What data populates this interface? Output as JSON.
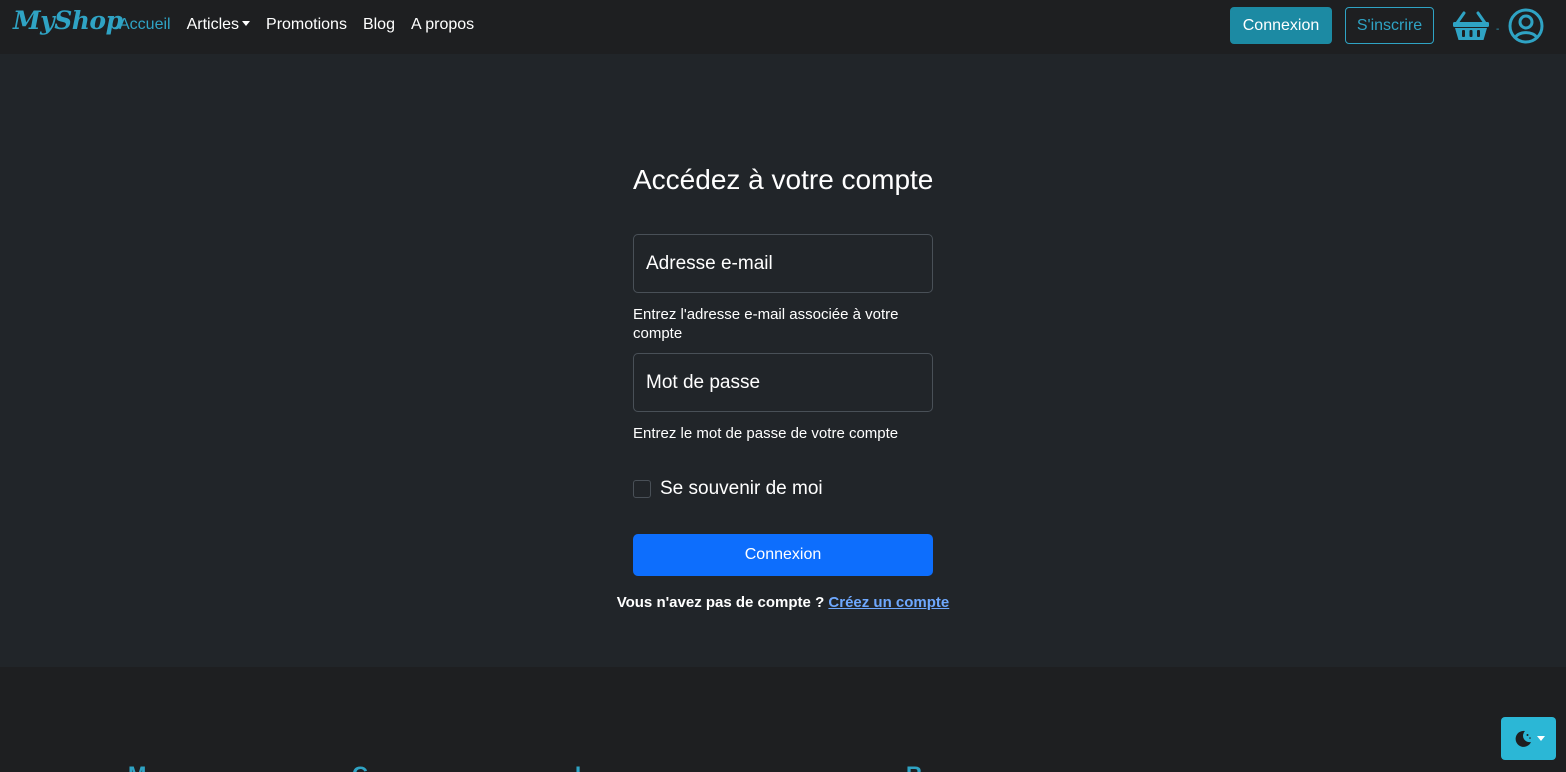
{
  "navbar": {
    "brand": "MyShop",
    "links": [
      {
        "label": "Accueil",
        "active": true
      },
      {
        "label": "Articles",
        "dropdown": true
      },
      {
        "label": "Promotions"
      },
      {
        "label": "Blog"
      },
      {
        "label": "A propos"
      }
    ],
    "login_label": "Connexion",
    "register_label": "S'inscrire",
    "cart_count": "-",
    "accent_color": "#2fa3c4"
  },
  "login_form": {
    "title": "Accédez à votre compte",
    "email_placeholder": "Adresse e-mail",
    "email_help": "Entrez l'adresse e-mail associée à votre compte",
    "password_placeholder": "Mot de passe",
    "password_help": "Entrez le mot de passe de votre compte",
    "remember_label": "Se souvenir de moi",
    "remember_checked": false,
    "submit_label": "Connexion",
    "signup_prompt": "Vous n'avez pas de compte ?",
    "signup_link": "Créez un compte"
  },
  "footer": {
    "headings": [
      "M",
      "C",
      "I",
      "R"
    ]
  },
  "theme_toggle": {
    "icon": "moon-stars-icon"
  }
}
